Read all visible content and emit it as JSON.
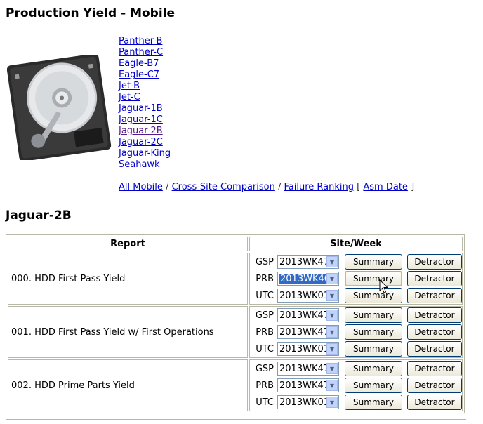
{
  "page_title": "Production Yield - Mobile",
  "products": [
    {
      "label": "Panther-B",
      "visited": false
    },
    {
      "label": "Panther-C",
      "visited": false
    },
    {
      "label": "Eagle-B7",
      "visited": false
    },
    {
      "label": "Eagle-C7",
      "visited": false
    },
    {
      "label": "Jet-B",
      "visited": false
    },
    {
      "label": "Jet-C",
      "visited": false
    },
    {
      "label": "Jaguar-1B",
      "visited": false
    },
    {
      "label": "Jaguar-1C",
      "visited": false
    },
    {
      "label": "Jaguar-2B",
      "visited": true
    },
    {
      "label": "Jaguar-2C",
      "visited": false
    },
    {
      "label": "Jaguar-King",
      "visited": false
    },
    {
      "label": "Seahawk",
      "visited": false
    }
  ],
  "links": {
    "all_mobile": "All Mobile",
    "sep1": "/",
    "cross_site": "Cross-Site Comparison",
    "sep2": "/",
    "failure": "Failure Ranking",
    "bracket_open": "[",
    "asm_date": "Asm Date",
    "bracket_close": "]"
  },
  "section_title": "Jaguar-2B",
  "table": {
    "header_report": "Report",
    "header_site": "Site/Week",
    "summary_label": "Summary",
    "detractor_label": "Detractor",
    "reports": [
      {
        "name": "000. HDD First Pass Yield",
        "sites": [
          {
            "code": "GSP",
            "week": "2013WK47"
          },
          {
            "code": "PRB",
            "week": "2013WK46",
            "focused": true,
            "hover": true
          },
          {
            "code": "UTC",
            "week": "2013WK01"
          }
        ]
      },
      {
        "name": "001. HDD First Pass Yield w/ First Operations",
        "sites": [
          {
            "code": "GSP",
            "week": "2013WK47"
          },
          {
            "code": "PRB",
            "week": "2013WK47"
          },
          {
            "code": "UTC",
            "week": "2013WK01"
          }
        ]
      },
      {
        "name": "002. HDD Prime Parts Yield",
        "sites": [
          {
            "code": "GSP",
            "week": "2013WK47"
          },
          {
            "code": "PRB",
            "week": "2013WK47"
          },
          {
            "code": "UTC",
            "week": "2013WK01"
          }
        ]
      }
    ]
  }
}
